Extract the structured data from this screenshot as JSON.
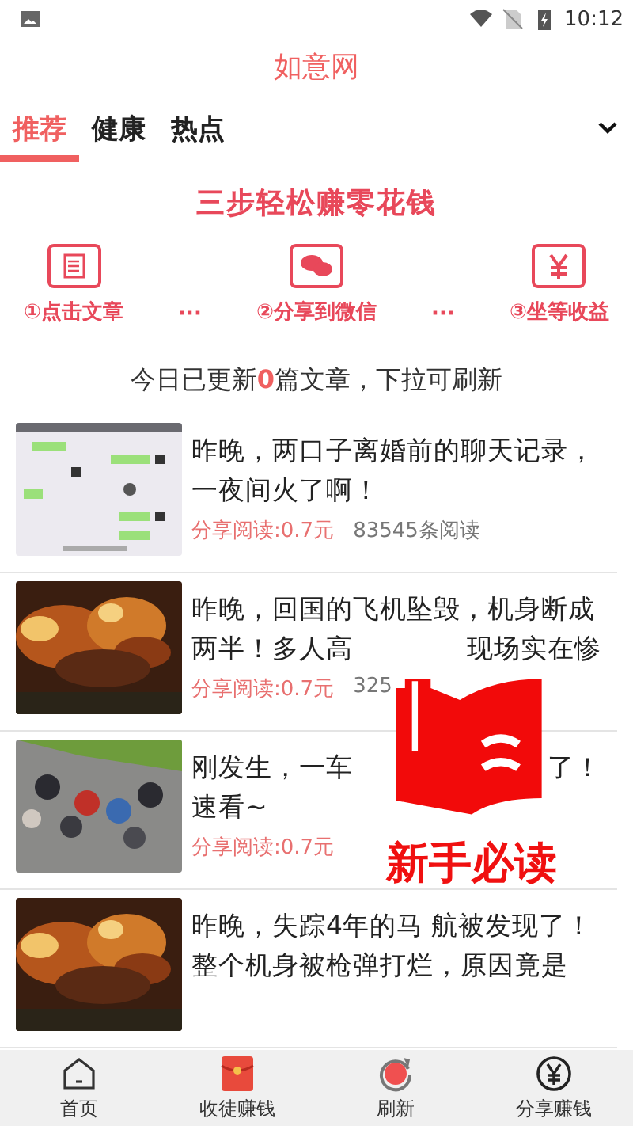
{
  "status_bar": {
    "time": "10:12"
  },
  "app_title": "如意网",
  "tabs": [
    {
      "label": "推荐",
      "selected": true
    },
    {
      "label": "健康",
      "selected": false
    },
    {
      "label": "热点",
      "selected": false
    }
  ],
  "banner": {
    "title": "三步轻松赚零花钱",
    "steps": [
      {
        "kind": "article",
        "label": "①点击文章"
      },
      {
        "kind": "wechat",
        "label": "②分享到微信"
      },
      {
        "kind": "money",
        "label": "③坐等收益"
      }
    ],
    "separator": "···"
  },
  "notice": {
    "before": "今日已更新",
    "count": "0",
    "after": "篇文章，下拉可刷新"
  },
  "articles": [
    {
      "kind": "picture",
      "lines": [
        [
          "昨晚，两口子离婚前的聊天记录，"
        ],
        [
          "一夜间火了啊！"
        ]
      ],
      "reward": "分享阅读:0.7元",
      "reads": "83545条阅读"
    },
    {
      "kind": "picture",
      "lines": [
        [
          "昨晚，回国的飞机坠毁，机身断成"
        ],
        [
          "两半！多人高",
          "现场实在惨"
        ]
      ],
      "reward": "分享阅读:0.7元",
      "reads": "325"
    },
    {
      "kind": "picture",
      "lines": [
        [
          "刚发生，一车",
          "了！"
        ],
        [
          "速看~"
        ]
      ],
      "reward": "分享阅读:0.7元"
    },
    {
      "kind": "picture",
      "lines": [
        [
          "昨晚，失踪4年的马 航被发现了！"
        ],
        [
          "整个机身被枪弹打烂，原因竟是"
        ]
      ]
    }
  ],
  "floating_badge": {
    "label": "新手必读"
  },
  "bottom_nav": [
    {
      "kind": "home",
      "label": "首页"
    },
    {
      "kind": "envelope",
      "label": "收徒赚钱"
    },
    {
      "kind": "refresh",
      "label": "刷新"
    },
    {
      "kind": "yuan",
      "label": "分享赚钱"
    }
  ]
}
